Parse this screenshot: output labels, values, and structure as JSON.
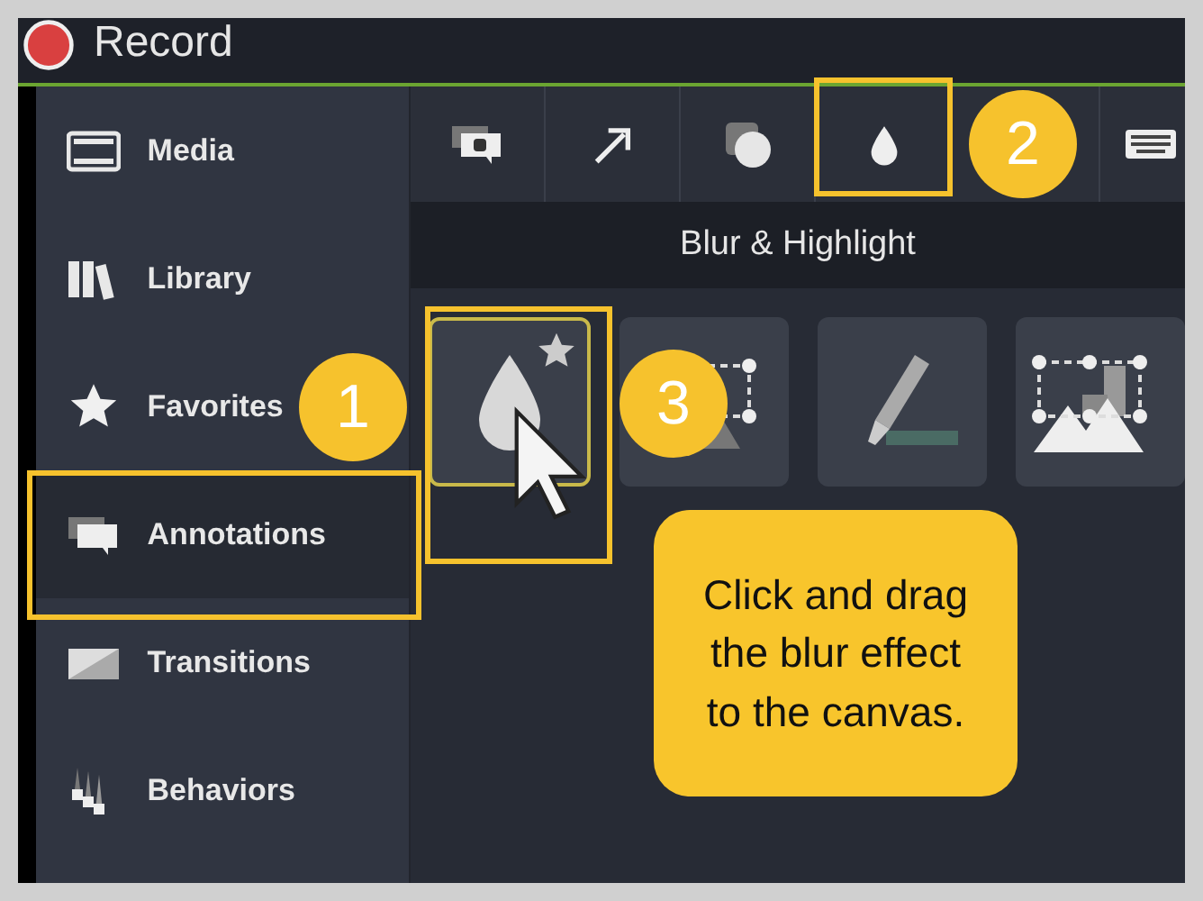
{
  "header": {
    "title": "Record"
  },
  "sidebar": {
    "items": [
      {
        "kind": "media",
        "label": "Media",
        "selected": false
      },
      {
        "kind": "library",
        "label": "Library",
        "selected": false
      },
      {
        "kind": "favorites",
        "label": "Favorites",
        "selected": false
      },
      {
        "kind": "annotations",
        "label": "Annotations",
        "selected": true
      },
      {
        "kind": "transitions",
        "label": "Transitions",
        "selected": false
      },
      {
        "kind": "behaviors",
        "label": "Behaviors",
        "selected": false
      }
    ]
  },
  "toolbar": {
    "tabs": [
      {
        "kind": "callout"
      },
      {
        "kind": "arrow"
      },
      {
        "kind": "shape"
      },
      {
        "kind": "blur"
      },
      {
        "kind": "keyboard"
      }
    ]
  },
  "panel": {
    "title": "Blur & Highlight",
    "tiles": [
      {
        "kind": "blur",
        "selected": true
      },
      {
        "kind": "spotlight",
        "selected": false
      },
      {
        "kind": "highlight",
        "selected": false
      },
      {
        "kind": "pixelate",
        "selected": false
      }
    ]
  },
  "steps": [
    "1",
    "2",
    "3"
  ],
  "tip": "Click and drag the blur effect to the canvas."
}
